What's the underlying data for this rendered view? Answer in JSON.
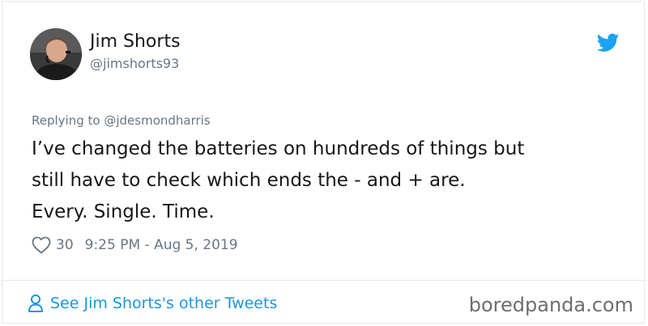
{
  "tweet": {
    "author": {
      "display_name": "Jim Shorts",
      "handle": "@jimshorts93"
    },
    "replying_to_prefix": "Replying to ",
    "replying_to_handle": "@jdesmondharris",
    "text_lines": [
      "I’ve changed the batteries on hundreds of things but",
      "still have to check which ends the - and + are.",
      "Every. Single. Time."
    ],
    "like_count": "30",
    "timestamp": "9:25 PM - Aug 5, 2019"
  },
  "footer": {
    "other_tweets_label": "See Jim Shorts's other Tweets"
  },
  "watermark": {
    "text": "boredpanda.com"
  },
  "icons": {
    "brand": "twitter-bird-icon",
    "like": "heart-icon",
    "profile": "person-icon"
  },
  "colors": {
    "twitter_blue": "#1da1f2",
    "link_blue": "#1b95e0",
    "secondary_text": "#657786",
    "primary_text": "#14171a"
  }
}
